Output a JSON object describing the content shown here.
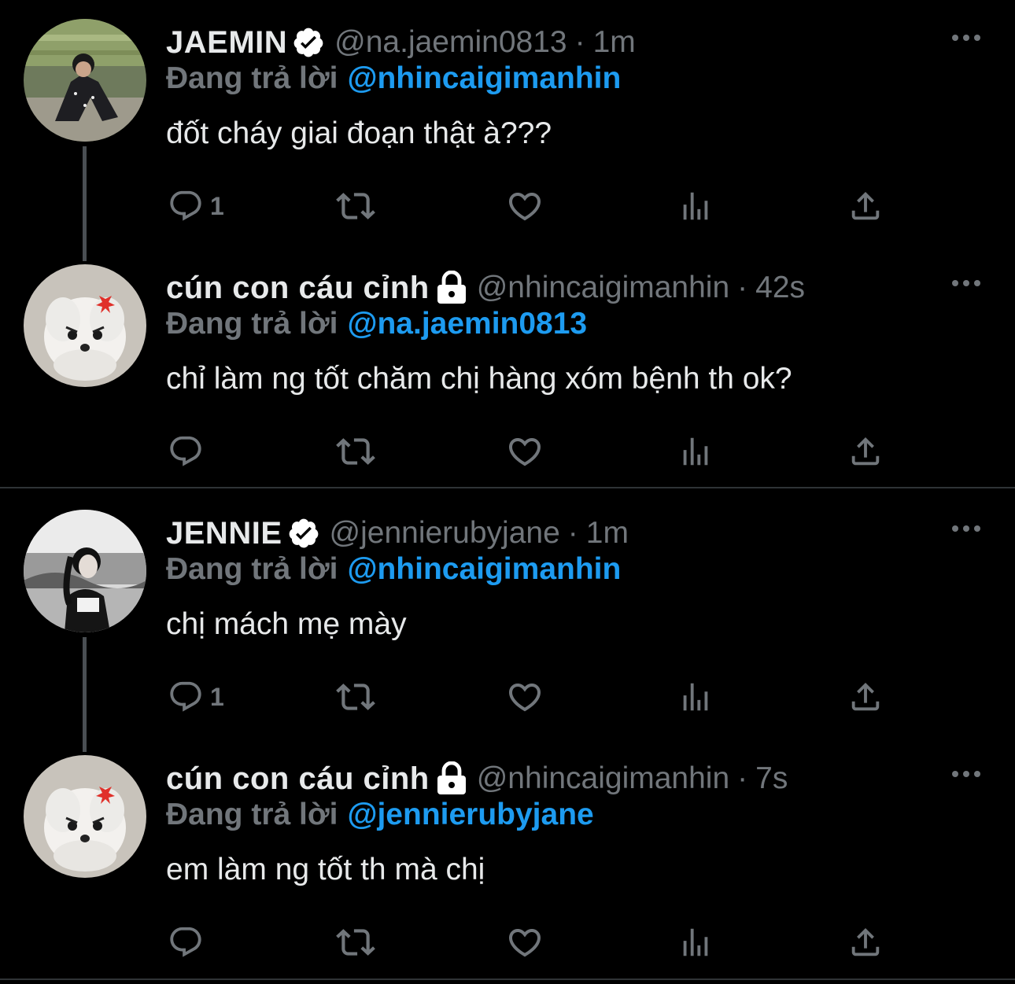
{
  "colors": {
    "background": "#000000",
    "text": "#e7e9ea",
    "muted": "#71767b",
    "link": "#1d9bf0",
    "thread_line": "#4a4f53",
    "divider": "#2f3336"
  },
  "tweets": [
    {
      "name": "JAEMIN",
      "verified": true,
      "protected": false,
      "handle": "@na.jaemin0813",
      "dot": "·",
      "time": "1m",
      "replying_label": "Đang trả lời",
      "replying_to": "@nhincaigimanhin",
      "text": "đốt cháy giai đoạn thật à???",
      "reply_count": "1",
      "avatar": "man-sitting-photo"
    },
    {
      "name": "cún con cáu cỉnh",
      "verified": false,
      "protected": true,
      "handle": "@nhincaigimanhin",
      "dot": "·",
      "time": "42s",
      "replying_label": "Đang trả lời",
      "replying_to": "@na.jaemin0813",
      "text": "chỉ làm ng tốt chăm chị hàng xóm bệnh th ok?",
      "reply_count": "",
      "avatar": "angry-white-puppy"
    },
    {
      "name": "JENNIE",
      "verified": true,
      "protected": false,
      "handle": "@jennierubyjane",
      "dot": "·",
      "time": "1m",
      "replying_label": "Đang trả lời",
      "replying_to": "@nhincaigimanhin",
      "text": "chị mách mẹ mày",
      "reply_count": "1",
      "avatar": "woman-bw-photo"
    },
    {
      "name": "cún con cáu cỉnh",
      "verified": false,
      "protected": true,
      "handle": "@nhincaigimanhin",
      "dot": "·",
      "time": "7s",
      "replying_label": "Đang trả lời",
      "replying_to": "@jennierubyjane",
      "text": "em làm ng tốt th mà chị",
      "reply_count": "",
      "avatar": "angry-white-puppy"
    }
  ]
}
